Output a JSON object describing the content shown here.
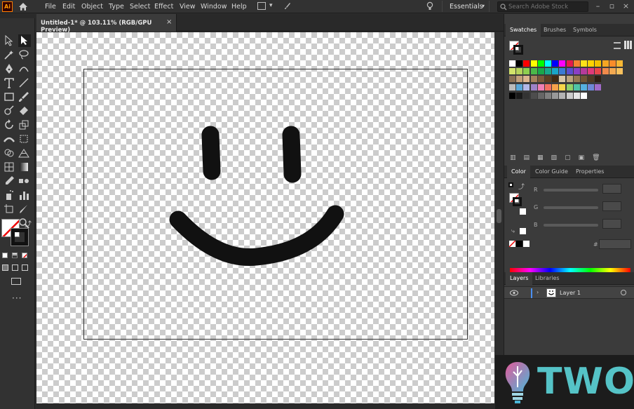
{
  "app": {
    "logo_text": "Ai"
  },
  "menu": {
    "items": [
      "File",
      "Edit",
      "Object",
      "Type",
      "Select",
      "Effect",
      "View",
      "Window",
      "Help"
    ],
    "workspace_label": "Essentials",
    "search_placeholder": "Search Adobe Stock"
  },
  "document": {
    "tab_title": "Untitled-1* @ 103.11% (RGB/GPU Preview)",
    "close_glyph": "×"
  },
  "panels": {
    "swatch_tabs": [
      "Swatches",
      "Brushes",
      "Symbols"
    ],
    "color_tabs": [
      "Color",
      "Color Guide",
      "Properties"
    ],
    "color_channels": [
      "R",
      "G",
      "B"
    ],
    "hex_prefix": "#",
    "layer_tabs": [
      "Layers",
      "Libraries"
    ],
    "layers": [
      {
        "name": "Layer 1"
      }
    ]
  },
  "watermark": {
    "text": "TWOS"
  },
  "colors": {
    "accent_orange": "#ff7c00",
    "layer_blue": "#4b8ff0",
    "watermark_teal": "#55c3c7"
  }
}
